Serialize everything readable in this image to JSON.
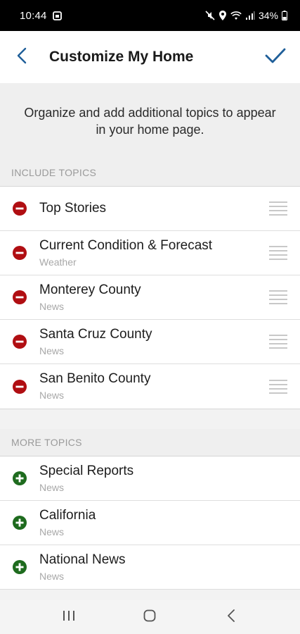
{
  "status_bar": {
    "time": "10:44",
    "battery": "34%",
    "icons": [
      "gallery-notification-icon",
      "mute-icon",
      "location-icon",
      "wifi-icon",
      "signal-icon",
      "battery-icon"
    ]
  },
  "app_bar": {
    "title": "Customize My Home",
    "back_icon": "chevron-left-icon",
    "done_icon": "checkmark-icon"
  },
  "intro": {
    "text": "Organize and add additional topics to appear in your home page."
  },
  "include_section": {
    "header": "INCLUDE TOPICS",
    "items": [
      {
        "title": "Top Stories",
        "subtitle": ""
      },
      {
        "title": "Current Condition & Forecast",
        "subtitle": "Weather"
      },
      {
        "title": "Monterey County",
        "subtitle": "News"
      },
      {
        "title": "Santa Cruz County",
        "subtitle": "News"
      },
      {
        "title": "San Benito County",
        "subtitle": "News"
      }
    ]
  },
  "more_section": {
    "header": "MORE TOPICS",
    "items": [
      {
        "title": "Special Reports",
        "subtitle": "News"
      },
      {
        "title": "California",
        "subtitle": "News"
      },
      {
        "title": "National News",
        "subtitle": "News"
      }
    ]
  },
  "colors": {
    "accent": "#1f5f99",
    "remove": "#b00e12",
    "add": "#1e6b1e"
  }
}
